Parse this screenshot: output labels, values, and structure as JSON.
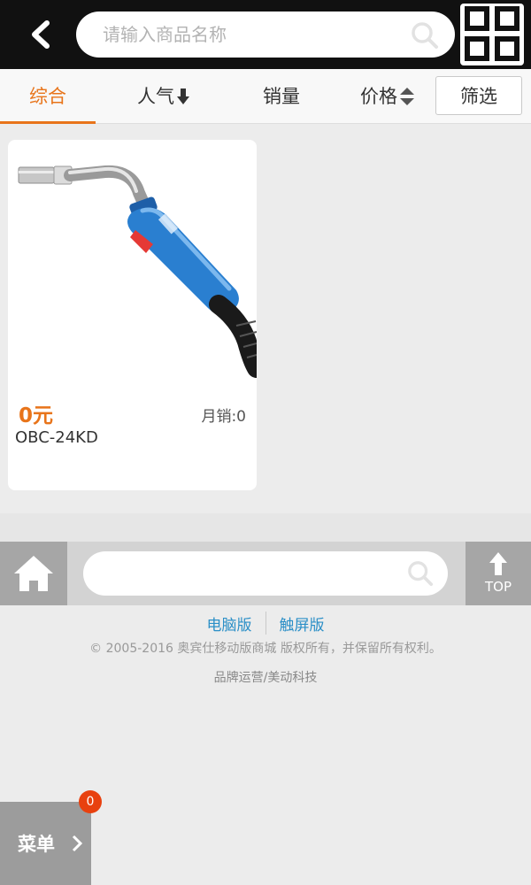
{
  "header": {
    "search_placeholder": "请输入商品名称"
  },
  "sort_tabs": [
    {
      "label": "综合",
      "active": true
    },
    {
      "label": "人气"
    },
    {
      "label": "销量"
    },
    {
      "label": "价格"
    }
  ],
  "filter_label": "筛选",
  "products": [
    {
      "price": "0元",
      "monthly_sales": "月销:0",
      "name": "OBC-24KD"
    }
  ],
  "bottom_bar": {
    "search_placeholder": "",
    "top_label": "TOP"
  },
  "footer": {
    "links": [
      "电脑版",
      "触屏版"
    ],
    "copyright": "© 2005-2016 奥宾仕移动版商城 版权所有，并保留所有权利。",
    "brand": "品牌运营/美动科技"
  },
  "menu": {
    "label": "菜单",
    "badge": "0"
  },
  "colors": {
    "accent": "#e8741a",
    "header_bg": "#111111",
    "link": "#2b8fc7",
    "badge": "#e8410f",
    "product_blue": "#2a7fd0"
  }
}
